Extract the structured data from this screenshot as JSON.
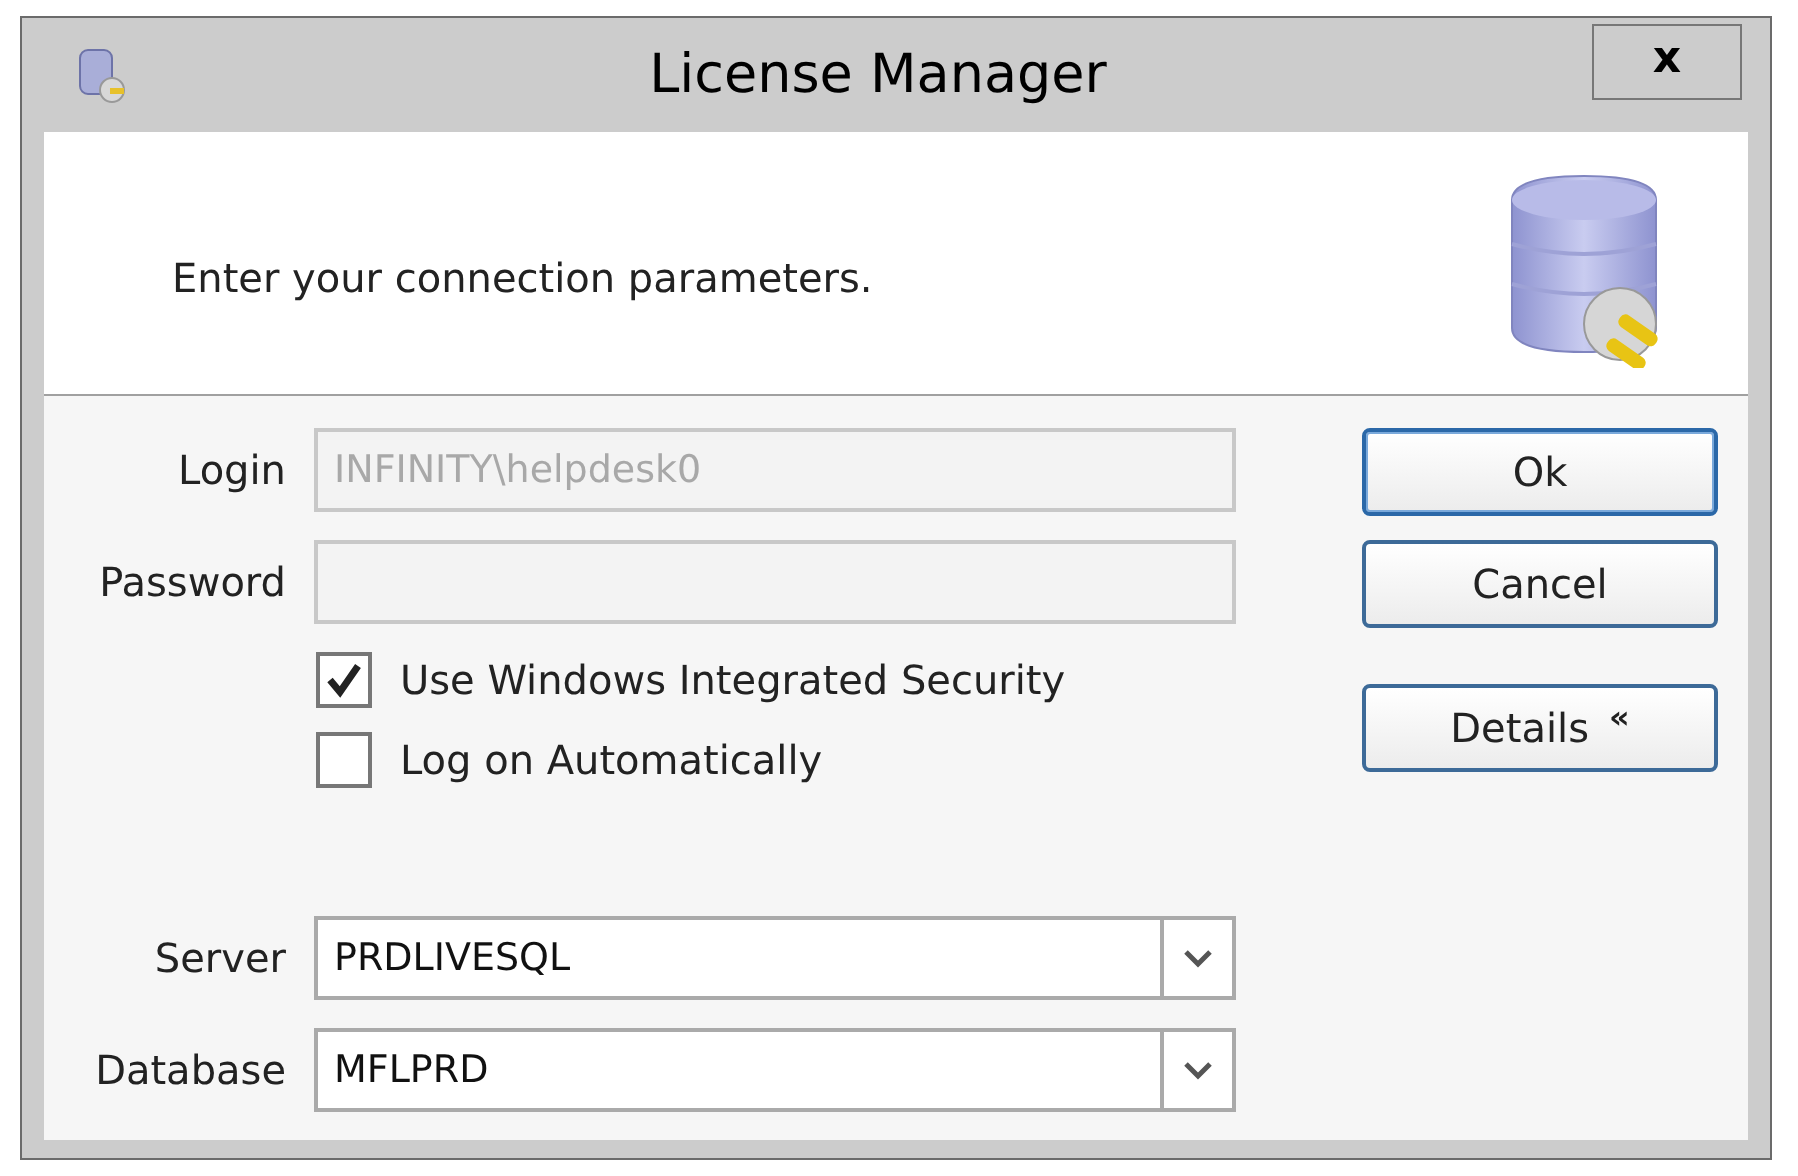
{
  "window": {
    "title": "License Manager",
    "close": "x"
  },
  "header": {
    "text": "Enter your connection parameters."
  },
  "fields": [
    {
      "kind": "text",
      "label": "Login",
      "value": "INFINITY\\helpdesk0",
      "disabled": true
    },
    {
      "kind": "password",
      "label": "Password",
      "disabled": true
    }
  ],
  "options": [
    {
      "label": "Use Windows Integrated Security",
      "checked": true
    },
    {
      "label": "Log on Automatically",
      "checked": false
    }
  ],
  "combos": [
    {
      "label": "Server",
      "value": "PRDLIVESQL"
    },
    {
      "label": "Database",
      "value": "MFLPRD"
    }
  ],
  "buttons": [
    {
      "label": "Ok",
      "kind": "default"
    },
    {
      "label": "Cancel",
      "kind": "normal"
    },
    {
      "label": "Details",
      "kind": "expander",
      "glyph": "«"
    }
  ]
}
